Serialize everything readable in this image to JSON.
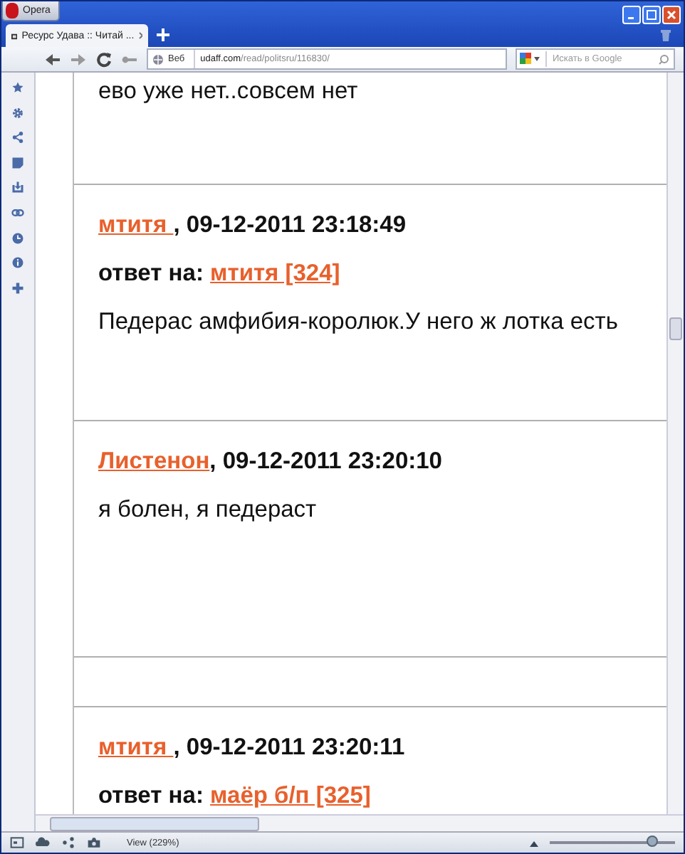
{
  "window": {
    "app_button": "Opera"
  },
  "tabs": [
    {
      "title": "Ресурс Удава :: Читай ...",
      "selected": true
    }
  ],
  "toolbar": {
    "address_prefix": "Веб",
    "address_host": "udaff.com",
    "address_path": "/read/politsru/116830/",
    "search": {
      "placeholder": "Искать в Google"
    }
  },
  "posts": [
    {
      "kind": "fragment",
      "text": "ево уже нет..совсем нет"
    },
    {
      "kind": "comment",
      "author": "мтитя ",
      "date": ", 09-12-2011 23:18:49",
      "reply_label": "ответ на:",
      "reply_to": "мтитя [324]",
      "text": "Педерас амфибия-королюк.У него ж лотка есть"
    },
    {
      "kind": "comment",
      "author": "Листенон",
      "date": ", 09-12-2011 23:20:10",
      "text": "я болен, я педераст"
    },
    {
      "kind": "spacer"
    },
    {
      "kind": "comment",
      "author": "мтитя ",
      "date": ", 09-12-2011 23:20:11",
      "reply_label": "ответ на:",
      "reply_to": "маёр б/п [325]"
    }
  ],
  "status_bar": {
    "zoom_label": "View (229%)",
    "zoom": {
      "level": 0.82
    }
  }
}
